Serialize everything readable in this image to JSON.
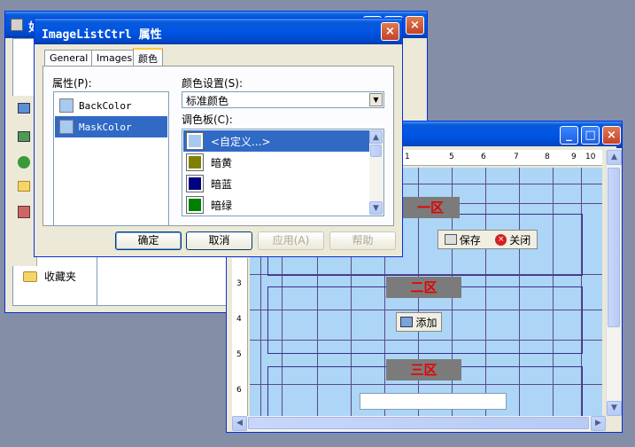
{
  "window1": {
    "title": "如",
    "favorites_label": "收藏夹"
  },
  "editor": {
    "ruler_marks": [
      "1",
      "5",
      "6",
      "7",
      "8",
      "9",
      "10"
    ],
    "vruler_marks": [
      "3",
      "4",
      "5",
      "6"
    ],
    "zones": [
      "一区",
      "二区",
      "三区"
    ],
    "save_label": "保存",
    "close_label": "关闭",
    "add_label": "添加"
  },
  "dialog": {
    "title": "ImageListCtrl 属性",
    "tabs": [
      "General",
      "Images",
      "颜色"
    ],
    "property_label": "属性(P):",
    "properties": [
      {
        "name": "BackColor",
        "color": "#a6caf0"
      },
      {
        "name": "MaskColor",
        "color": "#a6caf0"
      }
    ],
    "color_set_label": "颜色设置(S):",
    "color_set_value": "标准颜色",
    "palette_label": "调色板(C):",
    "palette": [
      {
        "name": "<自定义...>",
        "color": "#a6caf0"
      },
      {
        "name": "暗黄",
        "color": "#808000"
      },
      {
        "name": "暗蓝",
        "color": "#000080"
      },
      {
        "name": "暗绿",
        "color": "#008000"
      }
    ],
    "buttons": {
      "ok": "确定",
      "cancel": "取消",
      "apply": "应用(A)",
      "help": "帮助"
    }
  }
}
